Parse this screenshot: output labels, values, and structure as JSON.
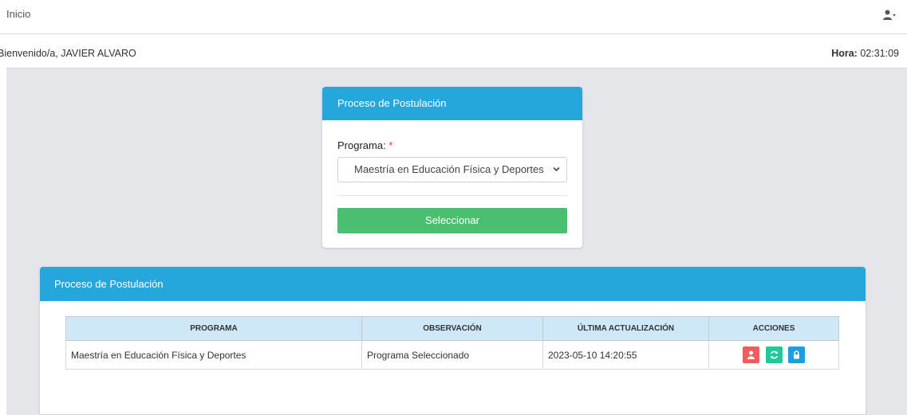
{
  "topbar": {
    "home_label": "Inicio",
    "user_icon": "user-dropdown-icon"
  },
  "welcome": {
    "message": "Bienvenido/a, JAVIER ALVARO",
    "time_label": "Hora:",
    "time_value": "02:31:09"
  },
  "selector_card": {
    "title": "Proceso de Postulación",
    "program_label": "Programa:",
    "required_mark": "*",
    "selected_program": "Maestría en Educación Física y Deportes",
    "button_label": "Seleccionar",
    "colors": {
      "header": "#26a7dc",
      "button": "#4cbe70"
    }
  },
  "process_card": {
    "title": "Proceso de Postulación",
    "columns": [
      "PROGRAMA",
      "OBSERVACIÓN",
      "ÚLTIMA ACTUALIZACIÓN",
      "ACCIONES"
    ],
    "rows": [
      {
        "programa": "Maestría en Educación Física y Deportes",
        "observacion": "Programa Seleccionado",
        "ultima_actualizacion": "2023-05-10 14:20:55",
        "acciones": [
          {
            "icon": "user-icon",
            "color": "#f25c5c"
          },
          {
            "icon": "refresh-icon",
            "color": "#20c997"
          },
          {
            "icon": "lock-icon",
            "color": "#1e9ee0"
          }
        ]
      }
    ]
  }
}
